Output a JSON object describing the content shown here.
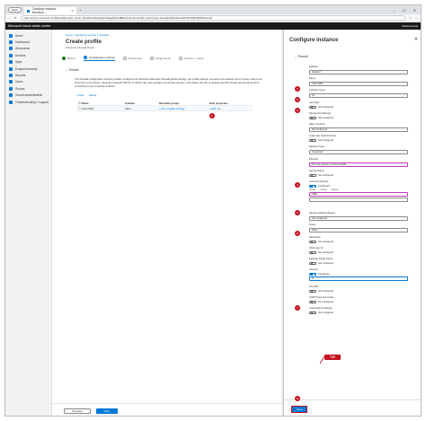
{
  "browser": {
    "workspace_label": "Work",
    "tab_title": "Configure instance - Microsoft ...",
    "url": "https://intune.microsoft.com/#view/Microsoft_Intune_Workflows/SettingsCatalogWizardBlade/intentControlId/~/policyType~/template/Windows10/CSP/PAPI/MDM/Firewall"
  },
  "app": {
    "title": "Microsoft Intune admin center",
    "user": "Nicole Forest"
  },
  "sidebar": {
    "items": [
      {
        "label": "Home"
      },
      {
        "label": "Dashboard"
      },
      {
        "label": "All services"
      },
      {
        "label": "Devices"
      },
      {
        "label": "Apps"
      },
      {
        "label": "Endpoint security"
      },
      {
        "label": "Reports"
      },
      {
        "label": "Users"
      },
      {
        "label": "Groups"
      },
      {
        "label": "Tenant administration"
      },
      {
        "label": "Troubleshooting + support"
      }
    ]
  },
  "main": {
    "breadcrumb": "Home > Endpoint security | Firewall >",
    "title": "Create profile",
    "subtitle": "Windows Firewall Rules",
    "steps": [
      {
        "label": "Basics",
        "state": "done"
      },
      {
        "label": "Configuration settings",
        "state": "active"
      },
      {
        "label": "Scope tags",
        "state": "pending"
      },
      {
        "label": "Assignments",
        "state": "pending"
      },
      {
        "label": "Review + create",
        "state": "pending"
      }
    ],
    "section": "Firewall",
    "description": "The Firewall configuration service provider configures the Windows Defender Firewall global settings, per profile settings, as well as the desired set of custom rules to be enforced on the device. Using the Firewall CSP the IT admin can now manage non-domain devices, and reduce the risk of network security threats across all systems connecting to the corporate network.",
    "table_actions": [
      "+ Add",
      "Delete"
    ],
    "columns": [
      "Name",
      "Enabled",
      "Reusable groups",
      "Rule properties"
    ],
    "rows": [
      {
        "name": "Allow RDP",
        "enabled": "Allow",
        "groups": "+ Set reusable settings",
        "props": "+ Edit rule"
      }
    ],
    "previous_label": "Previous",
    "next_label": "Next"
  },
  "panel": {
    "title": "Configure instance",
    "section": "Firewall",
    "fields": [
      {
        "label": "Enabled",
        "value": "Enabled",
        "kind": "dropdown",
        "badge": "1"
      },
      {
        "label": "Name",
        "value": "Allow RDP",
        "kind": "text",
        "badge": "2"
      },
      {
        "label": "Interface Types",
        "value": "All",
        "kind": "dropdown",
        "badge": "3"
      },
      {
        "label": "App Fqdn",
        "value": "Not configured",
        "kind": "toggle"
      },
      {
        "label": "Remote Port Ranges",
        "value": "Not configured",
        "kind": "toggle"
      },
      {
        "label": "Edge Traversal",
        "value": "Not configured",
        "kind": "dropdown"
      },
      {
        "label": "Local User Authorized List",
        "value": "Not configured",
        "kind": "toggle"
      },
      {
        "label": "Network Types",
        "value": "0 selected",
        "kind": "dropdown"
      },
      {
        "label": "Direction",
        "value": "The rule applies to inbound traffic.",
        "kind": "dropdown",
        "badge": "4"
      },
      {
        "label": "Service Name",
        "value": "Not configured",
        "kind": "toggle"
      },
      {
        "label": "Local Port Ranges",
        "value": "Configured",
        "kind": "toggle-on",
        "badge": "5"
      },
      {
        "label": "Remote Address Ranges",
        "value": "Not configured",
        "kind": "dropdown"
      },
      {
        "label": "Action",
        "value": "Allow",
        "kind": "dropdown"
      },
      {
        "label": "Description",
        "value": "Not configured",
        "kind": "toggle"
      },
      {
        "label": "Policy App Id",
        "value": "Not configured",
        "kind": "toggle"
      },
      {
        "label": "Package Family Name",
        "value": "Not configured",
        "kind": "toggle"
      },
      {
        "label": "Protocol",
        "value": "Configured",
        "kind": "toggle-on",
        "badge": "7"
      },
      {
        "label": "File Path",
        "value": "Not configured",
        "kind": "toggle"
      },
      {
        "label": "ICMP Types And Codes",
        "value": "Not configured",
        "kind": "toggle"
      },
      {
        "label": "Local Address Ranges",
        "value": "Not configured",
        "kind": "toggle"
      }
    ],
    "port_row": {
      "value": "3389",
      "actions": [
        "Delete",
        "Import",
        "Export"
      ],
      "badge": "6"
    },
    "protocol_value": "6",
    "protocol_callout": "TCP",
    "badge_save": "8",
    "save_label": "Save"
  },
  "colors": {
    "accent": "#0078d4",
    "badge": "#c50f1f",
    "highlight": "#c239b3"
  }
}
